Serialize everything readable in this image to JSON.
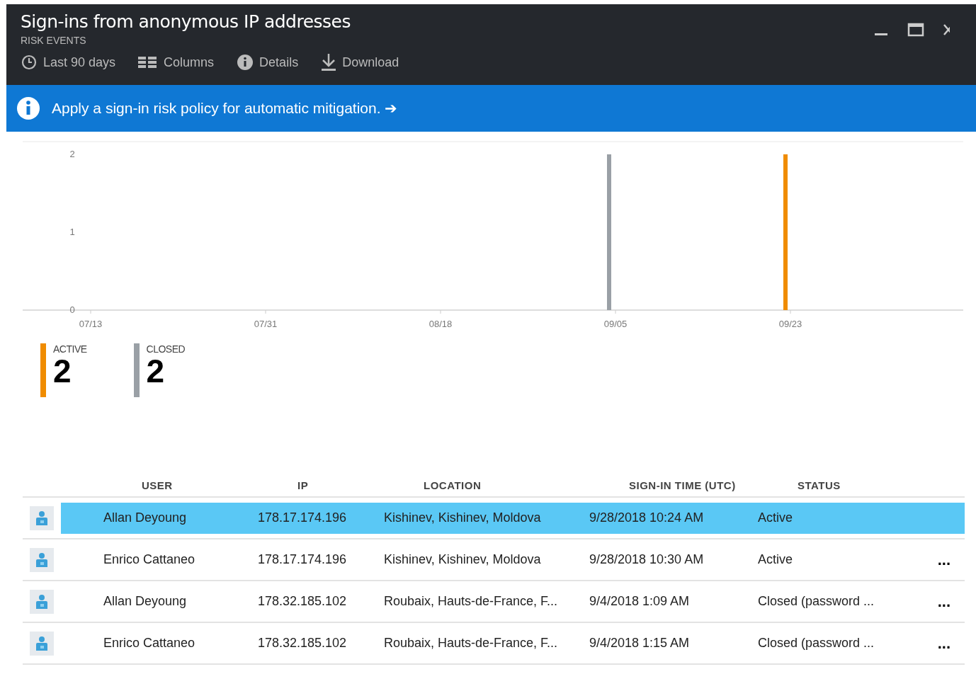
{
  "window": {
    "title": "Sign-ins from anonymous IP addresses",
    "subtitle": "RISK EVENTS"
  },
  "toolbar": [
    {
      "kind": "clock",
      "label": "Last 90 days"
    },
    {
      "kind": "columns",
      "label": "Columns"
    },
    {
      "kind": "info",
      "label": "Details"
    },
    {
      "kind": "download",
      "label": "Download"
    }
  ],
  "banner": {
    "text": "Apply a sign-in risk policy for automatic mitigation.",
    "arrow": "➔"
  },
  "chart": {
    "chart_data": {
      "type": "bar",
      "categories": [
        "07/13",
        "07/31",
        "08/18",
        "09/05",
        "09/23"
      ],
      "yticks": [
        0,
        1,
        2
      ],
      "ylim": [
        0,
        2
      ],
      "series": [
        {
          "color": "#9aa0a6",
          "values": [
            null,
            null,
            null,
            2,
            null
          ]
        },
        {
          "color": "#f08c00",
          "values": [
            null,
            null,
            null,
            null,
            2
          ]
        }
      ]
    }
  },
  "summary": [
    {
      "label": "ACTIVE",
      "count": "2",
      "color": "#f08c00"
    },
    {
      "label": "CLOSED",
      "count": "2",
      "color": "#9aa0a6"
    }
  ],
  "table": {
    "columns": [
      "USER",
      "IP",
      "LOCATION",
      "SIGN-IN TIME (UTC)",
      "STATUS"
    ],
    "rows": [
      {
        "selected": true,
        "cells": [
          "Allan Deyoung",
          "178.17.174.196",
          "Kishinev, Kishinev, Moldova",
          "9/28/2018 10:24 AM",
          "Active"
        ]
      },
      {
        "selected": false,
        "cells": [
          "Enrico Cattaneo",
          "178.17.174.196",
          "Kishinev, Kishinev, Moldova",
          "9/28/2018 10:30 AM",
          "Active"
        ],
        "more": "..."
      },
      {
        "selected": false,
        "cells": [
          "Allan Deyoung",
          "178.32.185.102",
          "Roubaix, Hauts-de-France, F...",
          "9/4/2018 1:09 AM",
          "Closed (password ..."
        ],
        "more": "..."
      },
      {
        "selected": false,
        "cells": [
          "Enrico Cattaneo",
          "178.32.185.102",
          "Roubaix, Hauts-de-France, F...",
          "9/4/2018 1:15 AM",
          "Closed (password ..."
        ],
        "more": "..."
      }
    ]
  }
}
